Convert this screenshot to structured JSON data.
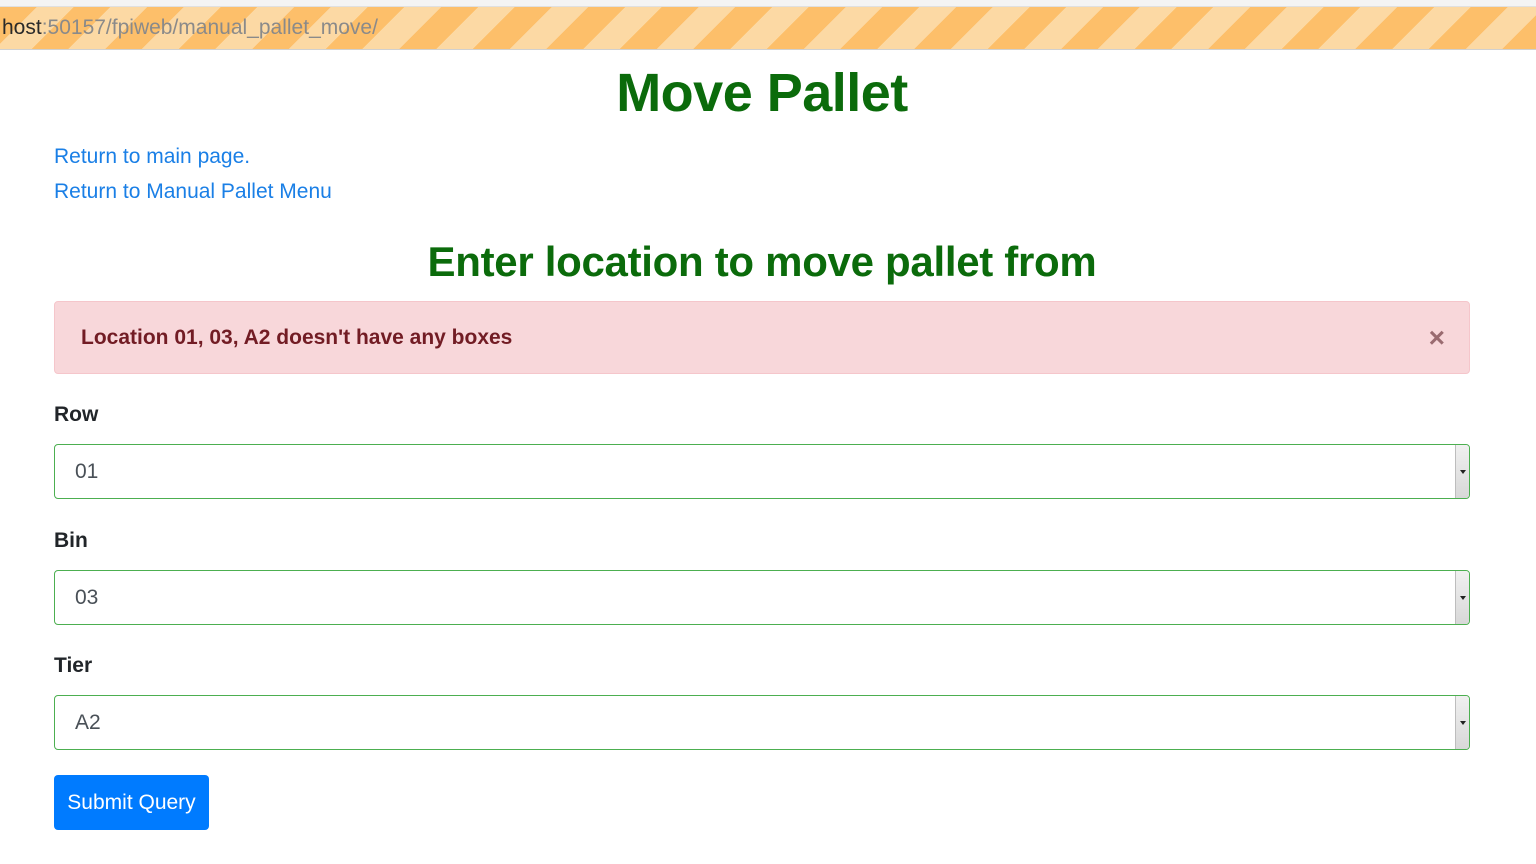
{
  "address_bar": {
    "host_text": "host",
    "rest_text": ":50157/fpiweb/manual_pallet_move/"
  },
  "page": {
    "title": "Move Pallet",
    "links": {
      "main_page": "Return to main page.",
      "pallet_menu": "Return to Manual Pallet Menu"
    },
    "section_title": "Enter location to move pallet from"
  },
  "alert": {
    "message": "Location 01, 03, A2 doesn't have any boxes",
    "close_symbol": "×",
    "type": "danger"
  },
  "form": {
    "row": {
      "label": "Row",
      "value": "01"
    },
    "bin": {
      "label": "Bin",
      "value": "03"
    },
    "tier": {
      "label": "Tier",
      "value": "A2"
    },
    "submit_label": "Submit Query"
  },
  "colors": {
    "title_green": "#0b6b0b",
    "link_blue": "#1a7fe6",
    "alert_bg": "#f8d7da",
    "alert_text": "#721c24",
    "input_border": "#4caf50",
    "button_blue": "#007bff"
  }
}
